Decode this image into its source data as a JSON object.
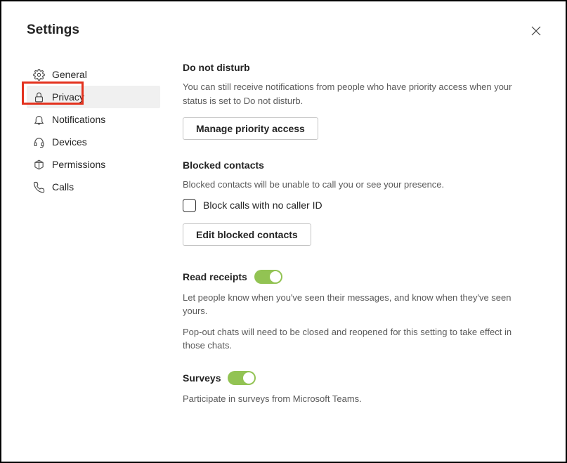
{
  "title": "Settings",
  "sidebar": {
    "items": [
      {
        "label": "General"
      },
      {
        "label": "Privacy"
      },
      {
        "label": "Notifications"
      },
      {
        "label": "Devices"
      },
      {
        "label": "Permissions"
      },
      {
        "label": "Calls"
      }
    ]
  },
  "privacy": {
    "dnd": {
      "heading": "Do not disturb",
      "desc": "You can still receive notifications from people who have priority access when your status is set to Do not disturb.",
      "button": "Manage priority access"
    },
    "blocked": {
      "heading": "Blocked contacts",
      "desc": "Blocked contacts will be unable to call you or see your presence.",
      "checkbox_label": "Block calls with no caller ID",
      "button": "Edit blocked contacts"
    },
    "read": {
      "heading": "Read receipts",
      "desc": "Let people know when you've seen their messages, and know when they've seen yours.",
      "desc2": "Pop-out chats will need to be closed and reopened for this setting to take effect in those chats."
    },
    "surveys": {
      "heading": "Surveys",
      "desc": "Participate in surveys from Microsoft Teams."
    }
  }
}
